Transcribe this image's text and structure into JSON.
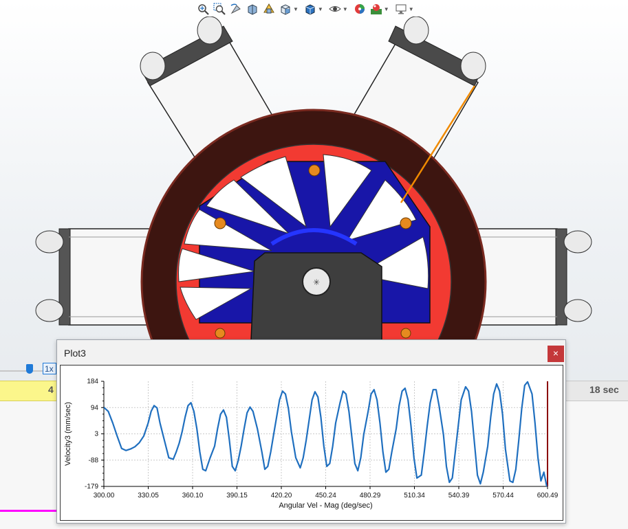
{
  "toolbar": {
    "items": [
      "zoom-to-fit-icon",
      "zoom-to-area-icon",
      "previous-view-icon",
      "section-view-icon",
      "dynamic-annotation-icon",
      "view-orientation-icon",
      "display-style-icon",
      "hide-show-items-icon",
      "edit-appearance-icon",
      "apply-scene-icon",
      "view-settings-icon"
    ]
  },
  "timeline": {
    "speed_label": "1x",
    "ruler_left_label": "4",
    "ruler_right_label": "18 sec"
  },
  "plot": {
    "window_title": "Plot3",
    "close_label": "×"
  },
  "chart_data": {
    "type": "line",
    "ylabel": "Velocity3 (mm/sec)",
    "xlabel": "Angular Vel - Mag (deg/sec)",
    "xlim": [
      300.0,
      600.49
    ],
    "ylim": [
      -179,
      184
    ],
    "x_ticks": [
      "300.00",
      "330.05",
      "360.10",
      "390.15",
      "420.20",
      "450.24",
      "480.29",
      "510.34",
      "540.39",
      "570.44",
      "600.49"
    ],
    "y_ticks": [
      "184",
      "94",
      "3",
      "-88",
      "-179"
    ],
    "grid": true,
    "color": "#1f6fbf",
    "series": [
      {
        "x": [
          300,
          303,
          306,
          309,
          312,
          315,
          318,
          321,
          324,
          327,
          330,
          332,
          334,
          336,
          338,
          341,
          344,
          347,
          349,
          351,
          353,
          355,
          357,
          359,
          361,
          363,
          365,
          367,
          369,
          372,
          375,
          377,
          379,
          381,
          383,
          385,
          387,
          389,
          391,
          393,
          395,
          397,
          399,
          401,
          404,
          407,
          409,
          411,
          413,
          415,
          417,
          419,
          421,
          423,
          425,
          427,
          430,
          433,
          435,
          437,
          439,
          441,
          443,
          445,
          447,
          449,
          451,
          453,
          455,
          457,
          460,
          462,
          464,
          466,
          468,
          470,
          472,
          474,
          476,
          479,
          481,
          483,
          485,
          487,
          489,
          491,
          493,
          495,
          498,
          500,
          502,
          504,
          506,
          508,
          510,
          512,
          515,
          517,
          519,
          521,
          523,
          525,
          527,
          530,
          532,
          534,
          536,
          538,
          540,
          542,
          545,
          547,
          549,
          551,
          553,
          555,
          557,
          560,
          562,
          564,
          566,
          568,
          570,
          572,
          575,
          577,
          579,
          581,
          583,
          585,
          587,
          590,
          592,
          594,
          596,
          598,
          600
        ],
        "y": [
          94,
          80,
          40,
          -5,
          -48,
          -55,
          -50,
          -42,
          -28,
          -5,
          40,
          80,
          100,
          92,
          40,
          -20,
          -80,
          -85,
          -60,
          -30,
          10,
          60,
          100,
          110,
          80,
          20,
          -60,
          -120,
          -125,
          -80,
          -40,
          20,
          70,
          85,
          60,
          -20,
          -110,
          -125,
          -90,
          -40,
          20,
          75,
          95,
          80,
          20,
          -60,
          -120,
          -110,
          -60,
          0,
          60,
          120,
          150,
          140,
          90,
          10,
          -80,
          -115,
          -80,
          -20,
          50,
          120,
          148,
          130,
          60,
          -40,
          -110,
          -100,
          -40,
          40,
          110,
          150,
          140,
          80,
          -10,
          -100,
          -125,
          -80,
          0,
          80,
          140,
          155,
          120,
          40,
          -60,
          -130,
          -120,
          -60,
          20,
          100,
          150,
          160,
          120,
          30,
          -80,
          -150,
          -140,
          -60,
          30,
          110,
          155,
          155,
          100,
          0,
          -110,
          -165,
          -150,
          -60,
          30,
          120,
          165,
          150,
          80,
          -30,
          -140,
          -170,
          -130,
          -40,
          60,
          140,
          175,
          150,
          70,
          -50,
          -160,
          -165,
          -120,
          -20,
          90,
          170,
          182,
          140,
          40,
          -80,
          -160,
          -130,
          -179
        ]
      }
    ]
  }
}
